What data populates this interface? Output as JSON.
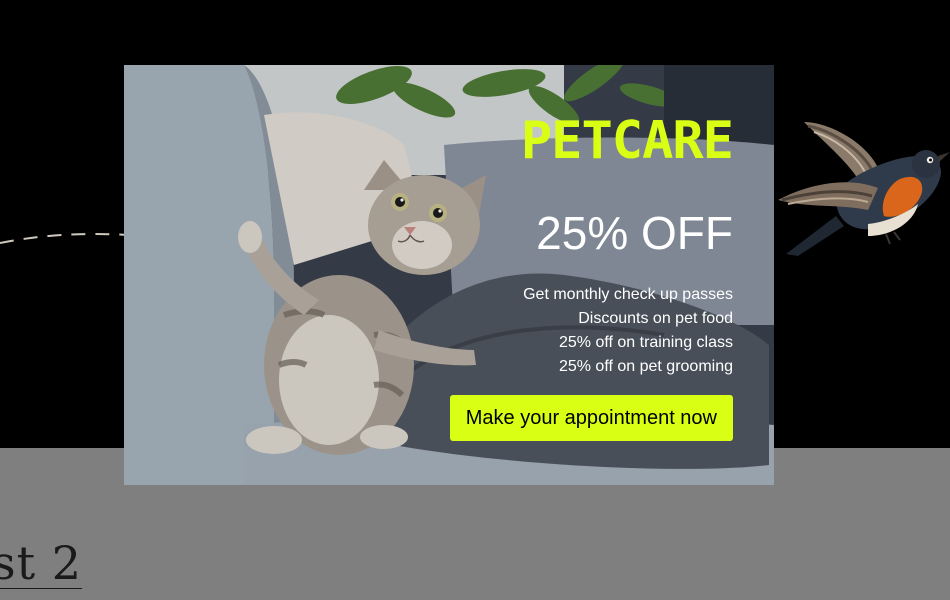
{
  "background_page": {
    "heading_fragment": "st 2"
  },
  "modal": {
    "brand": "PETCARE",
    "headline": "25% OFF",
    "benefits": [
      "Get monthly check up passes",
      "Discounts on pet food",
      "25% off on training class",
      "25% off on pet grooming"
    ],
    "cta_label": "Make your appointment now"
  },
  "colors": {
    "accent": "#d9ff14",
    "page_top": "#000000",
    "page_bottom": "#7f7f7f",
    "modal_text": "#ffffff"
  }
}
